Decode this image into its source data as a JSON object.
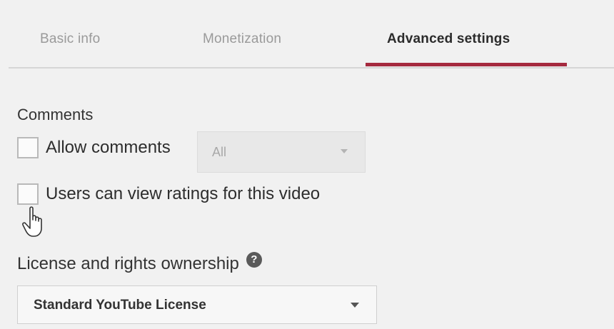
{
  "tabs": {
    "items": [
      {
        "label": "Basic info"
      },
      {
        "label": "Monetization"
      },
      {
        "label": "Advanced settings"
      }
    ],
    "active": "Advanced settings",
    "underline_color": "#a52a3f"
  },
  "comments": {
    "title": "Comments",
    "allow_comments": {
      "label": "Allow comments",
      "checked": false
    },
    "filter_select": {
      "value": "All"
    },
    "ratings": {
      "label": "Users can view ratings for this video",
      "checked": false
    }
  },
  "license": {
    "title": "License and rights ownership",
    "help_icon": "question-circle-icon",
    "select": {
      "value": "Standard YouTube License"
    }
  },
  "cursor": {
    "icon": "hand-pointer-icon"
  }
}
